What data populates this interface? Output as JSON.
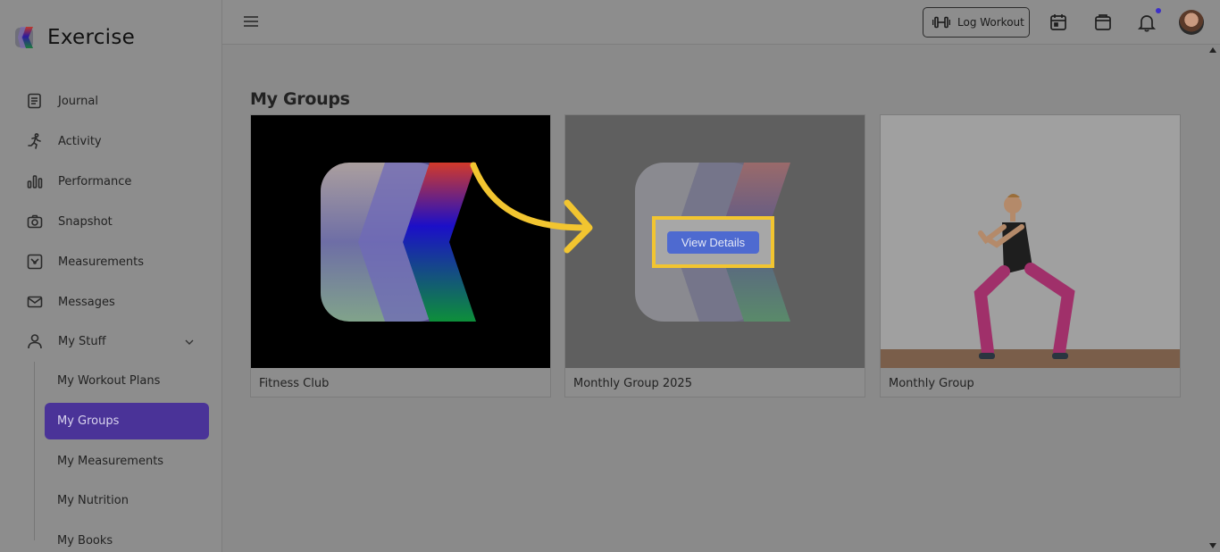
{
  "app": {
    "name": "Exercise"
  },
  "sidebar": {
    "items": [
      {
        "label": "Journal",
        "icon": "journal-icon"
      },
      {
        "label": "Activity",
        "icon": "running-icon"
      },
      {
        "label": "Performance",
        "icon": "bar-chart-icon"
      },
      {
        "label": "Snapshot",
        "icon": "camera-icon"
      },
      {
        "label": "Measurements",
        "icon": "measurement-icon"
      },
      {
        "label": "Messages",
        "icon": "mail-icon"
      },
      {
        "label": "My Stuff",
        "icon": "user-icon"
      }
    ],
    "sub_items": [
      {
        "label": "My Workout Plans"
      },
      {
        "label": "My Groups",
        "active": true
      },
      {
        "label": "My Measurements"
      },
      {
        "label": "My Nutrition"
      },
      {
        "label": "My Books"
      }
    ]
  },
  "header": {
    "log_workout_label": "Log Workout",
    "icons": [
      "menu-icon",
      "dumbbell-icon",
      "calendar-icon",
      "shopping-bag-icon",
      "bell-icon"
    ],
    "has_notification": true
  },
  "main": {
    "title": "My Groups",
    "groups": [
      {
        "name": "Fitness Club",
        "image": "logo-on-black"
      },
      {
        "name": "Monthly Group 2025",
        "image": "logo-on-gray",
        "hover_button": "View Details"
      },
      {
        "name": "Monthly Group",
        "image": "woman-squatting-photo"
      }
    ]
  },
  "colors": {
    "overlay": "#8a8a8a",
    "active_nav": "#4a3398",
    "highlight": "#f2c530",
    "view_button": "#4e6ad0"
  }
}
